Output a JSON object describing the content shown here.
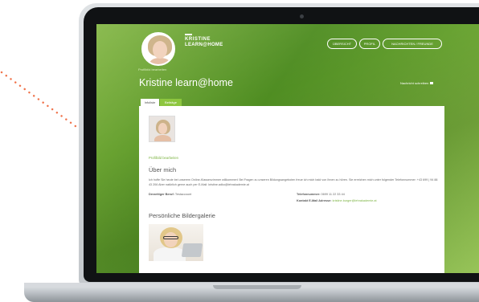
{
  "colors": {
    "accent": "#8dc63f",
    "screen_green": "#5a9a2a",
    "link": "#7cb342"
  },
  "header": {
    "avatar_edit_label": "Profilbild bearbeiten",
    "logo_line1": "KRISTINE",
    "logo_line2": "LEARN@HOME",
    "nav": [
      "ÜBERSICHT",
      "PROFIL",
      "NACHRICHTEN / FREUNDE"
    ]
  },
  "profile": {
    "title": "Kristine learn@home",
    "write_message": "Nachricht schreiben",
    "write_message_icon": "envelope-icon"
  },
  "tabs": [
    "Infoliste",
    "Beiträge"
  ],
  "panel": {
    "edit_link": "Profilbild bearbeiten",
    "about_heading": "Über mich",
    "about_text": "Ich hoffe Sie heute bei unserem Online-Klassenzimmer willkommen! Bei Fragen zu unseren Bildungsangeboten freue ich mich bald von Ihnen zu hören. Sie erreichen mich unter folgender Telefonnummer: +43 699 | 94 88 43 206 Aber natürlich gerne auch per E-Mail: kristine.adko@lehrakademie.at",
    "job_label": "Derzeitiger Beruf:",
    "job_value": "Testaccount",
    "phone_label": "Telefonnummer:",
    "phone_value": "0699 11 22 33 44",
    "contact_label": "Kontakt E-Mail Adresse:",
    "contact_value": "kristine.burger@lehrakademie.at",
    "gallery_heading": "Persönliche Bildergalerie"
  }
}
